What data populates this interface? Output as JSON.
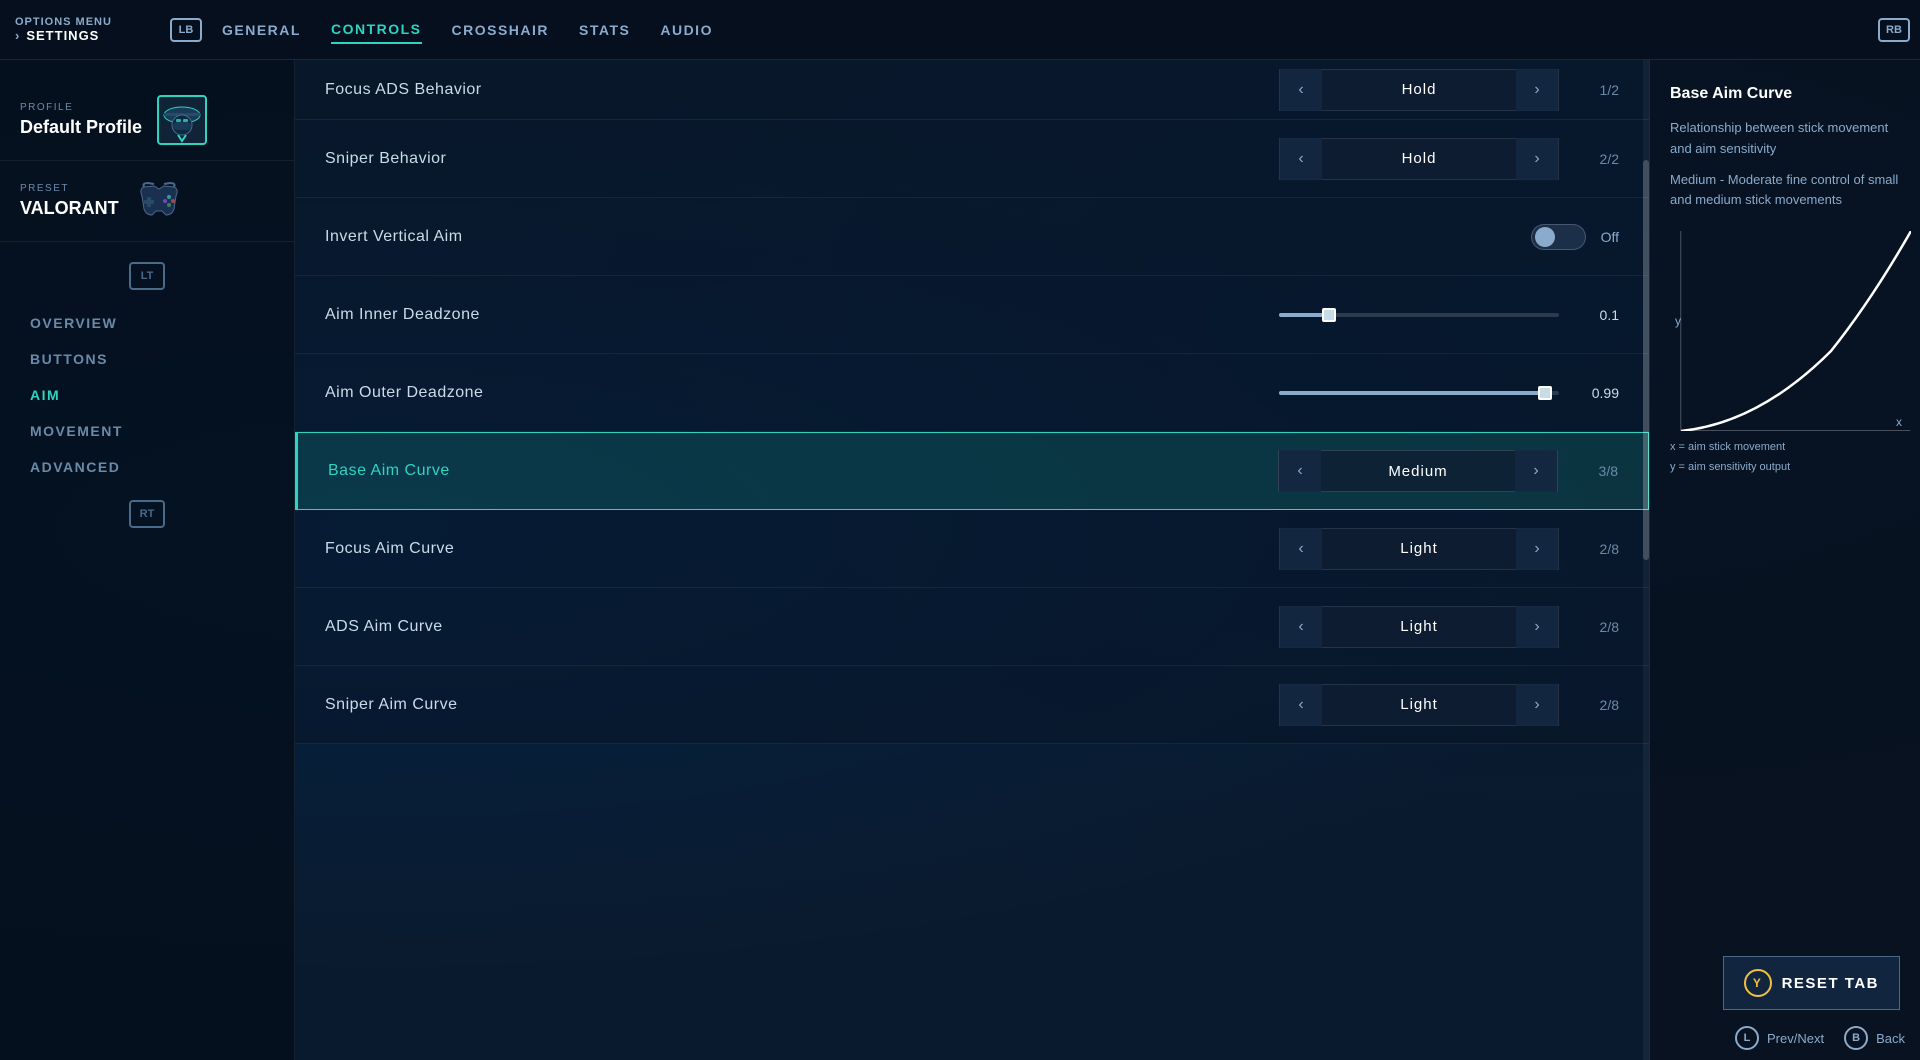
{
  "header": {
    "options_label": "OPTIONS MENU",
    "settings_label": "SETTINGS",
    "lb_badge": "LB",
    "rb_badge": "RB",
    "tabs": [
      {
        "label": "GENERAL",
        "active": false
      },
      {
        "label": "CONTROLS",
        "active": true
      },
      {
        "label": "CROSSHAIR",
        "active": false
      },
      {
        "label": "STATS",
        "active": false
      },
      {
        "label": "AUDIO",
        "active": false
      }
    ]
  },
  "sidebar": {
    "profile_label": "PROFILE",
    "profile_name": "Default Profile",
    "preset_label": "PRESET",
    "preset_name": "VALORANT",
    "lt_badge": "LT",
    "rt_badge": "RT",
    "menu_items": [
      {
        "label": "OVERVIEW",
        "active": false
      },
      {
        "label": "BUTTONS",
        "active": false
      },
      {
        "label": "AIM",
        "active": true
      },
      {
        "label": "MOVEMENT",
        "active": false
      },
      {
        "label": "ADVANCED",
        "active": false
      }
    ]
  },
  "settings": {
    "rows": [
      {
        "id": "focus-ads-behavior",
        "name": "Focus ADS Behavior",
        "control_type": "selector",
        "value": "Hold",
        "counter": "1/2"
      },
      {
        "id": "sniper-behavior",
        "name": "Sniper Behavior",
        "control_type": "selector",
        "value": "Hold",
        "counter": "2/2"
      },
      {
        "id": "invert-vertical-aim",
        "name": "Invert Vertical Aim",
        "control_type": "toggle",
        "value": "Off"
      },
      {
        "id": "aim-inner-deadzone",
        "name": "Aim Inner Deadzone",
        "control_type": "slider",
        "value": "0.1",
        "fill_percent": 18
      },
      {
        "id": "aim-outer-deadzone",
        "name": "Aim Outer Deadzone",
        "control_type": "slider",
        "value": "0.99",
        "fill_percent": 95
      },
      {
        "id": "base-aim-curve",
        "name": "Base Aim Curve",
        "control_type": "selector",
        "value": "Medium",
        "counter": "3/8",
        "highlighted": true
      },
      {
        "id": "focus-aim-curve",
        "name": "Focus Aim Curve",
        "control_type": "selector",
        "value": "Light",
        "counter": "2/8"
      },
      {
        "id": "ads-aim-curve",
        "name": "ADS Aim Curve",
        "control_type": "selector",
        "value": "Light",
        "counter": "2/8"
      },
      {
        "id": "sniper-aim-curve",
        "name": "Sniper Aim Curve",
        "control_type": "selector",
        "value": "Light",
        "counter": "2/8"
      }
    ]
  },
  "info_panel": {
    "title": "Base Aim Curve",
    "description1": "Relationship between stick movement and aim sensitivity",
    "description2": "Medium - Moderate fine control of small and medium stick movements",
    "axis_x_label": "x",
    "axis_y_label": "y",
    "legend_x": "x = aim stick movement",
    "legend_y": "y = aim sensitivity output",
    "reset_tab_label": "RESET TAB",
    "y_badge": "Y",
    "prev_next_label": "Prev/Next",
    "back_label": "Back",
    "l_badge": "L",
    "b_badge": "B"
  }
}
